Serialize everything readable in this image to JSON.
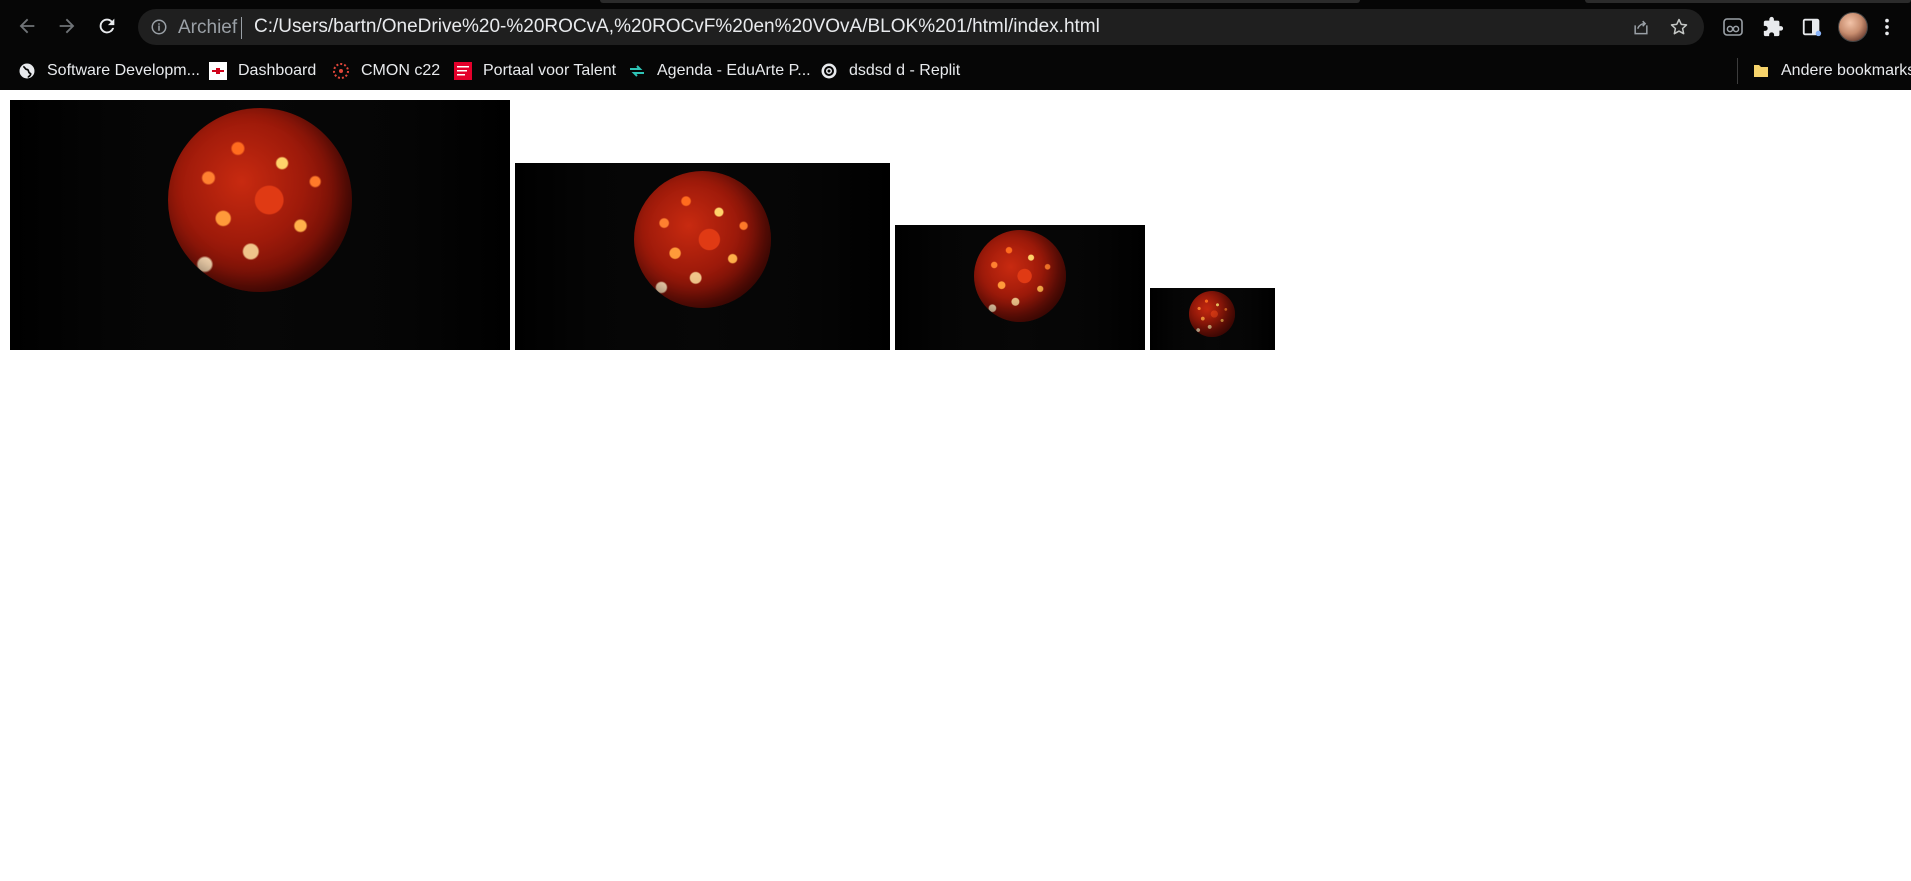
{
  "toolbar": {
    "back_icon": "back-arrow-icon",
    "forward_icon": "forward-arrow-icon",
    "reload_icon": "reload-icon",
    "omnibox": {
      "info_icon": "info-icon",
      "chip_label": "Archief",
      "url": "C:/Users/bartn/OneDrive%20-%20ROCvA,%20ROCvF%20en%20VOvA/BLOK%201/html/index.html",
      "share_icon": "share-icon",
      "star_icon": "bookmark-star-icon"
    },
    "extensions": [
      "glasses-icon",
      "puzzle-icon",
      "sidepanel-icon"
    ],
    "menu_icon": "kebab-menu-icon"
  },
  "bookmarks": {
    "items": [
      {
        "label": "Software Developm...",
        "icon": "globe-icon"
      },
      {
        "label": "Dashboard",
        "icon": "dashboard-favicon"
      },
      {
        "label": "CMON c22",
        "icon": "cmon-favicon"
      },
      {
        "label": "Portaal voor Talent",
        "icon": "portaal-favicon"
      },
      {
        "label": "Agenda - EduArte P...",
        "icon": "eduarte-favicon"
      },
      {
        "label": "dsdsd d - Replit",
        "icon": "replit-favicon"
      }
    ],
    "other_label": "Andere bookmarks",
    "other_icon": "folder-icon"
  },
  "colors": {
    "chrome_bg": "#060606",
    "omnibox_bg": "#1f1f1f",
    "page_bg": "#ffffff"
  },
  "page": {
    "images": [
      {
        "name": "planet-image-large",
        "icon": "planet-image"
      },
      {
        "name": "planet-image-medium",
        "icon": "planet-image"
      },
      {
        "name": "planet-image-small",
        "icon": "planet-image"
      },
      {
        "name": "planet-image-tiny",
        "icon": "planet-image"
      }
    ]
  }
}
